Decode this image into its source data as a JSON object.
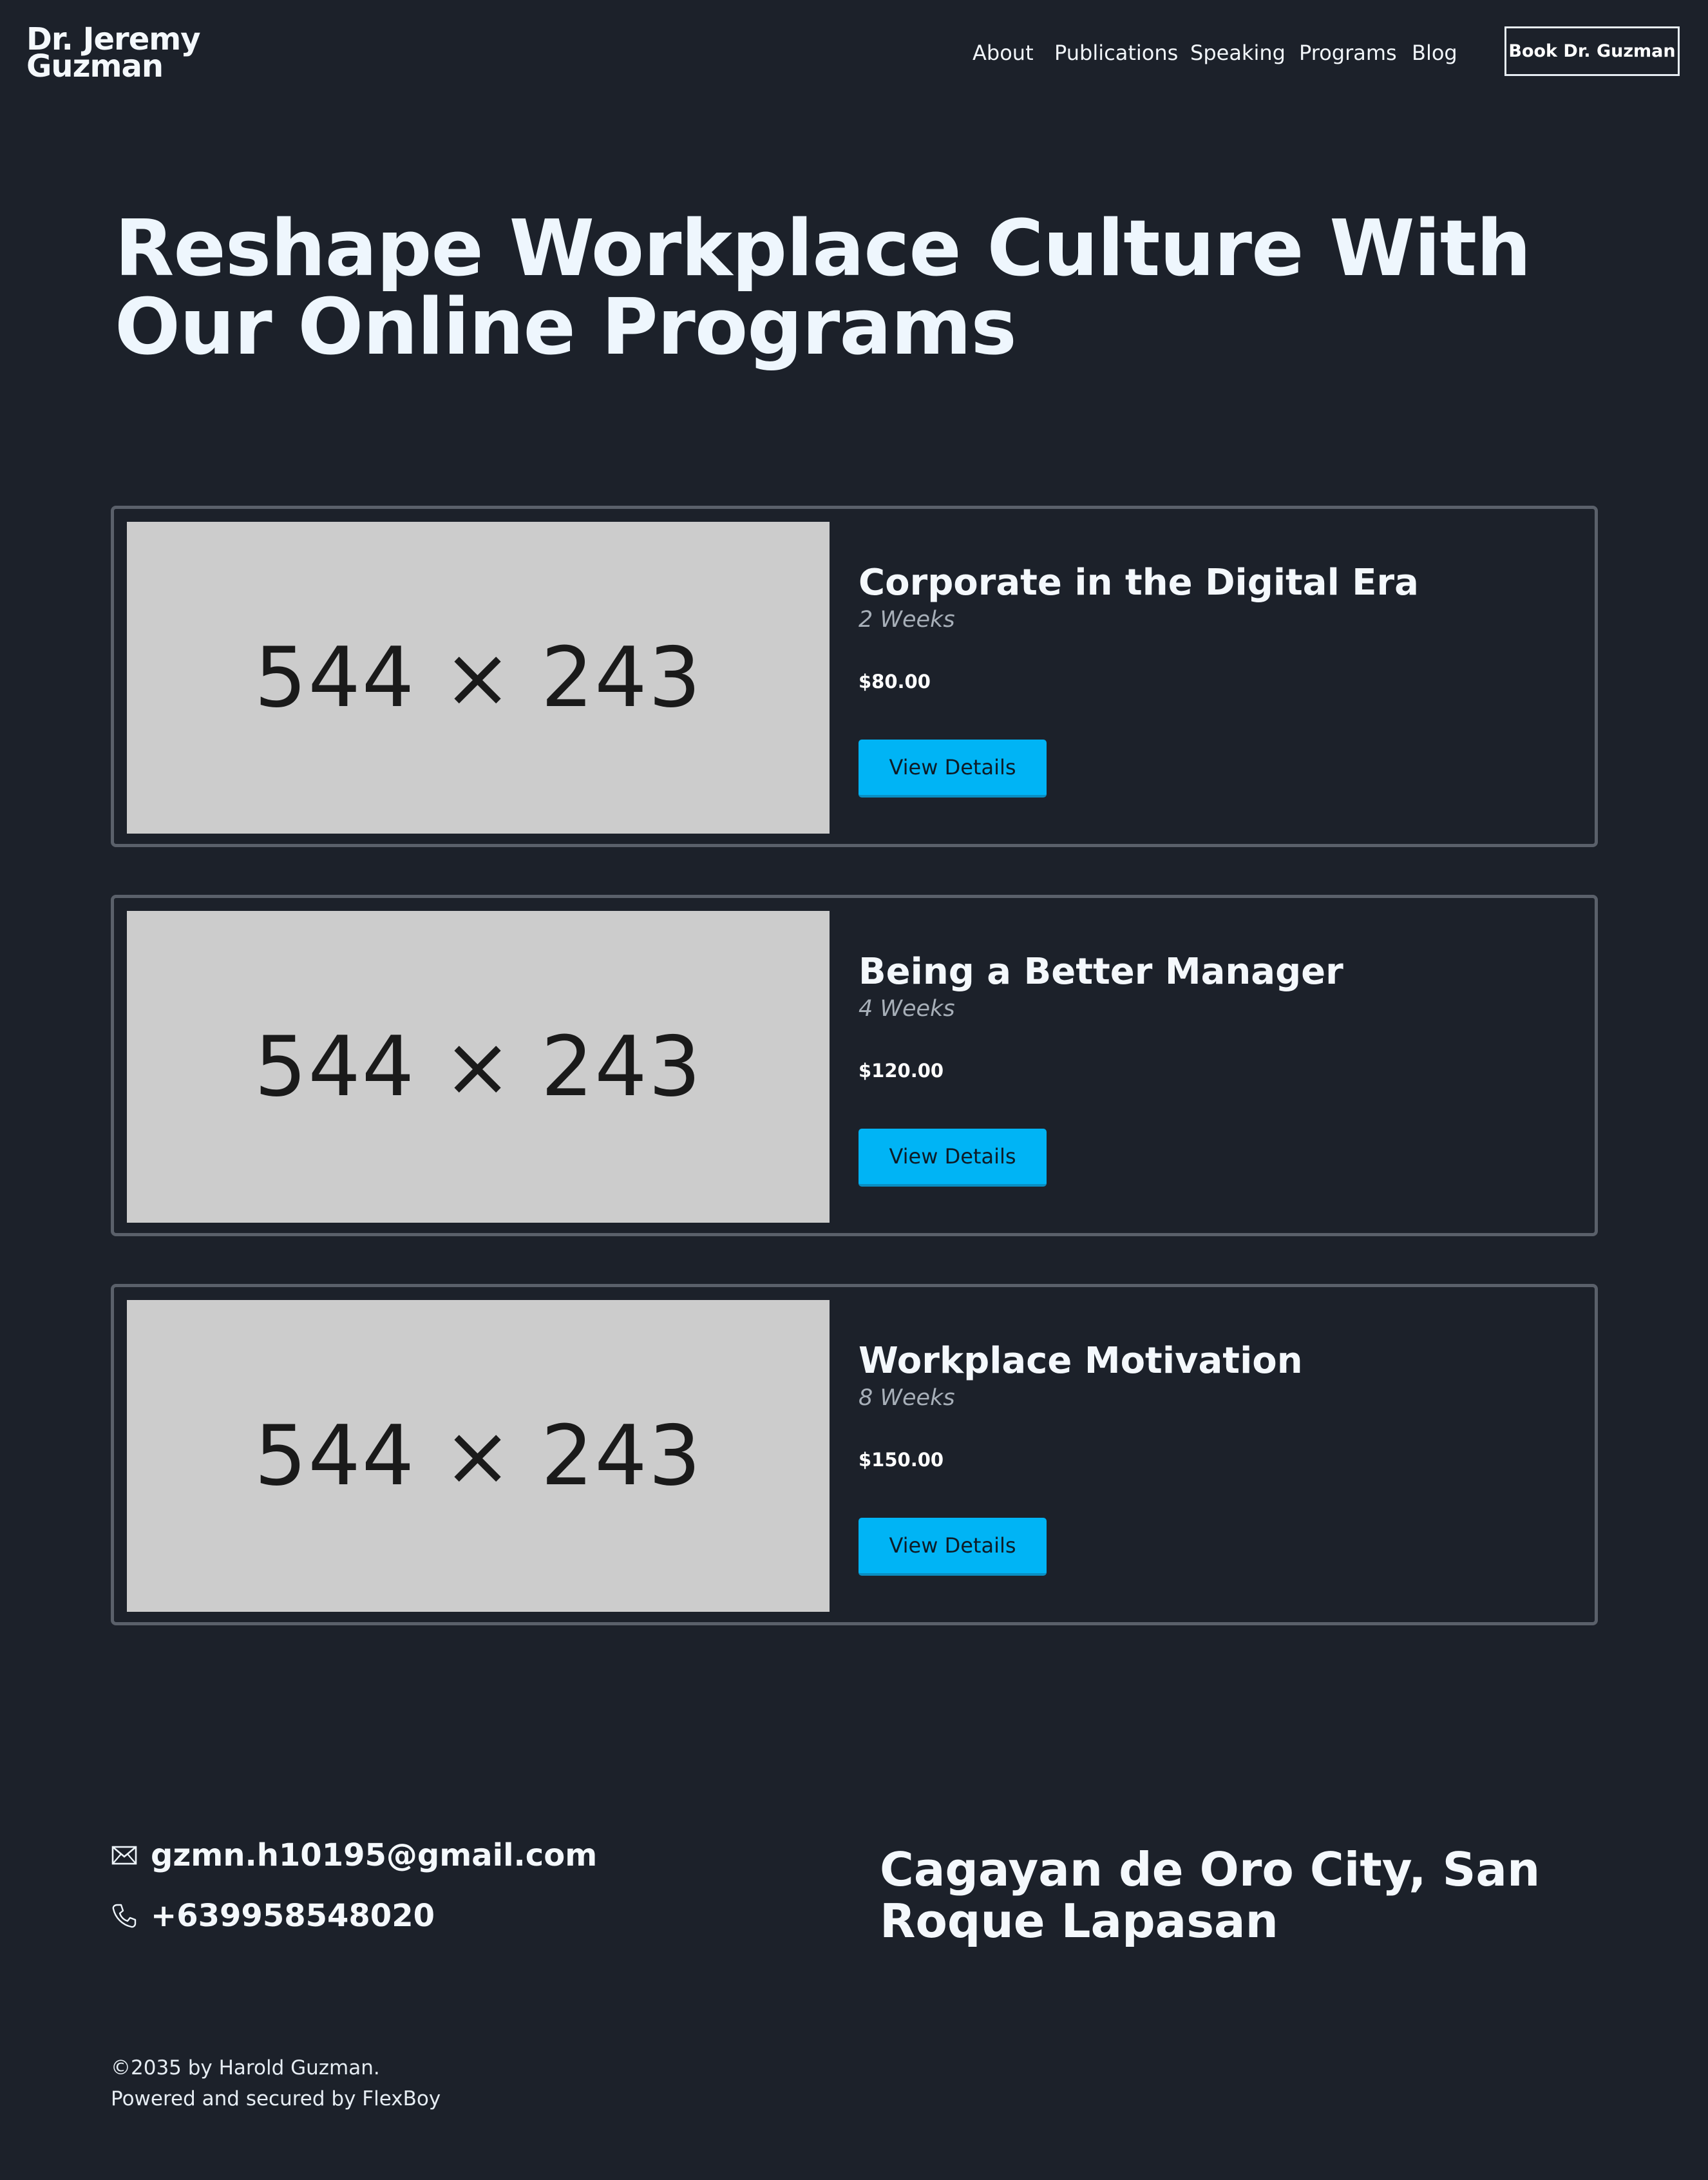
{
  "header": {
    "logo": "Dr. Jeremy Guzman",
    "nav": [
      "About",
      "Publications",
      "Speaking",
      "Programs",
      "Blog"
    ],
    "cta": "Book Dr. Guzman"
  },
  "hero": {
    "title": "Reshape Workplace Culture With Our Online Programs"
  },
  "programs": [
    {
      "image_placeholder": "544 × 243",
      "title": "Corporate in the Digital Era",
      "duration": "2 Weeks",
      "price": "$80.00",
      "button": "View Details"
    },
    {
      "image_placeholder": "544 × 243",
      "title": "Being a Better Manager",
      "duration": "4 Weeks",
      "price": "$120.00",
      "button": "View Details"
    },
    {
      "image_placeholder": "544 × 243",
      "title": "Workplace Motivation",
      "duration": "8 Weeks",
      "price": "$150.00",
      "button": "View Details"
    }
  ],
  "contact": {
    "email": "gzmn.h10195@gmail.com",
    "email_icon": "mail-icon",
    "phone": "+639958548020",
    "phone_icon": "phone-icon",
    "address": "Cagayan de Oro City, San Roque Lapasan"
  },
  "footer": {
    "copyright": "©2035 by Harold Guzman.",
    "powered": "Powered and secured by FlexBoy"
  },
  "colors": {
    "background": "#1c212a",
    "accent": "#00b4f5",
    "card_border": "#5a606a"
  }
}
